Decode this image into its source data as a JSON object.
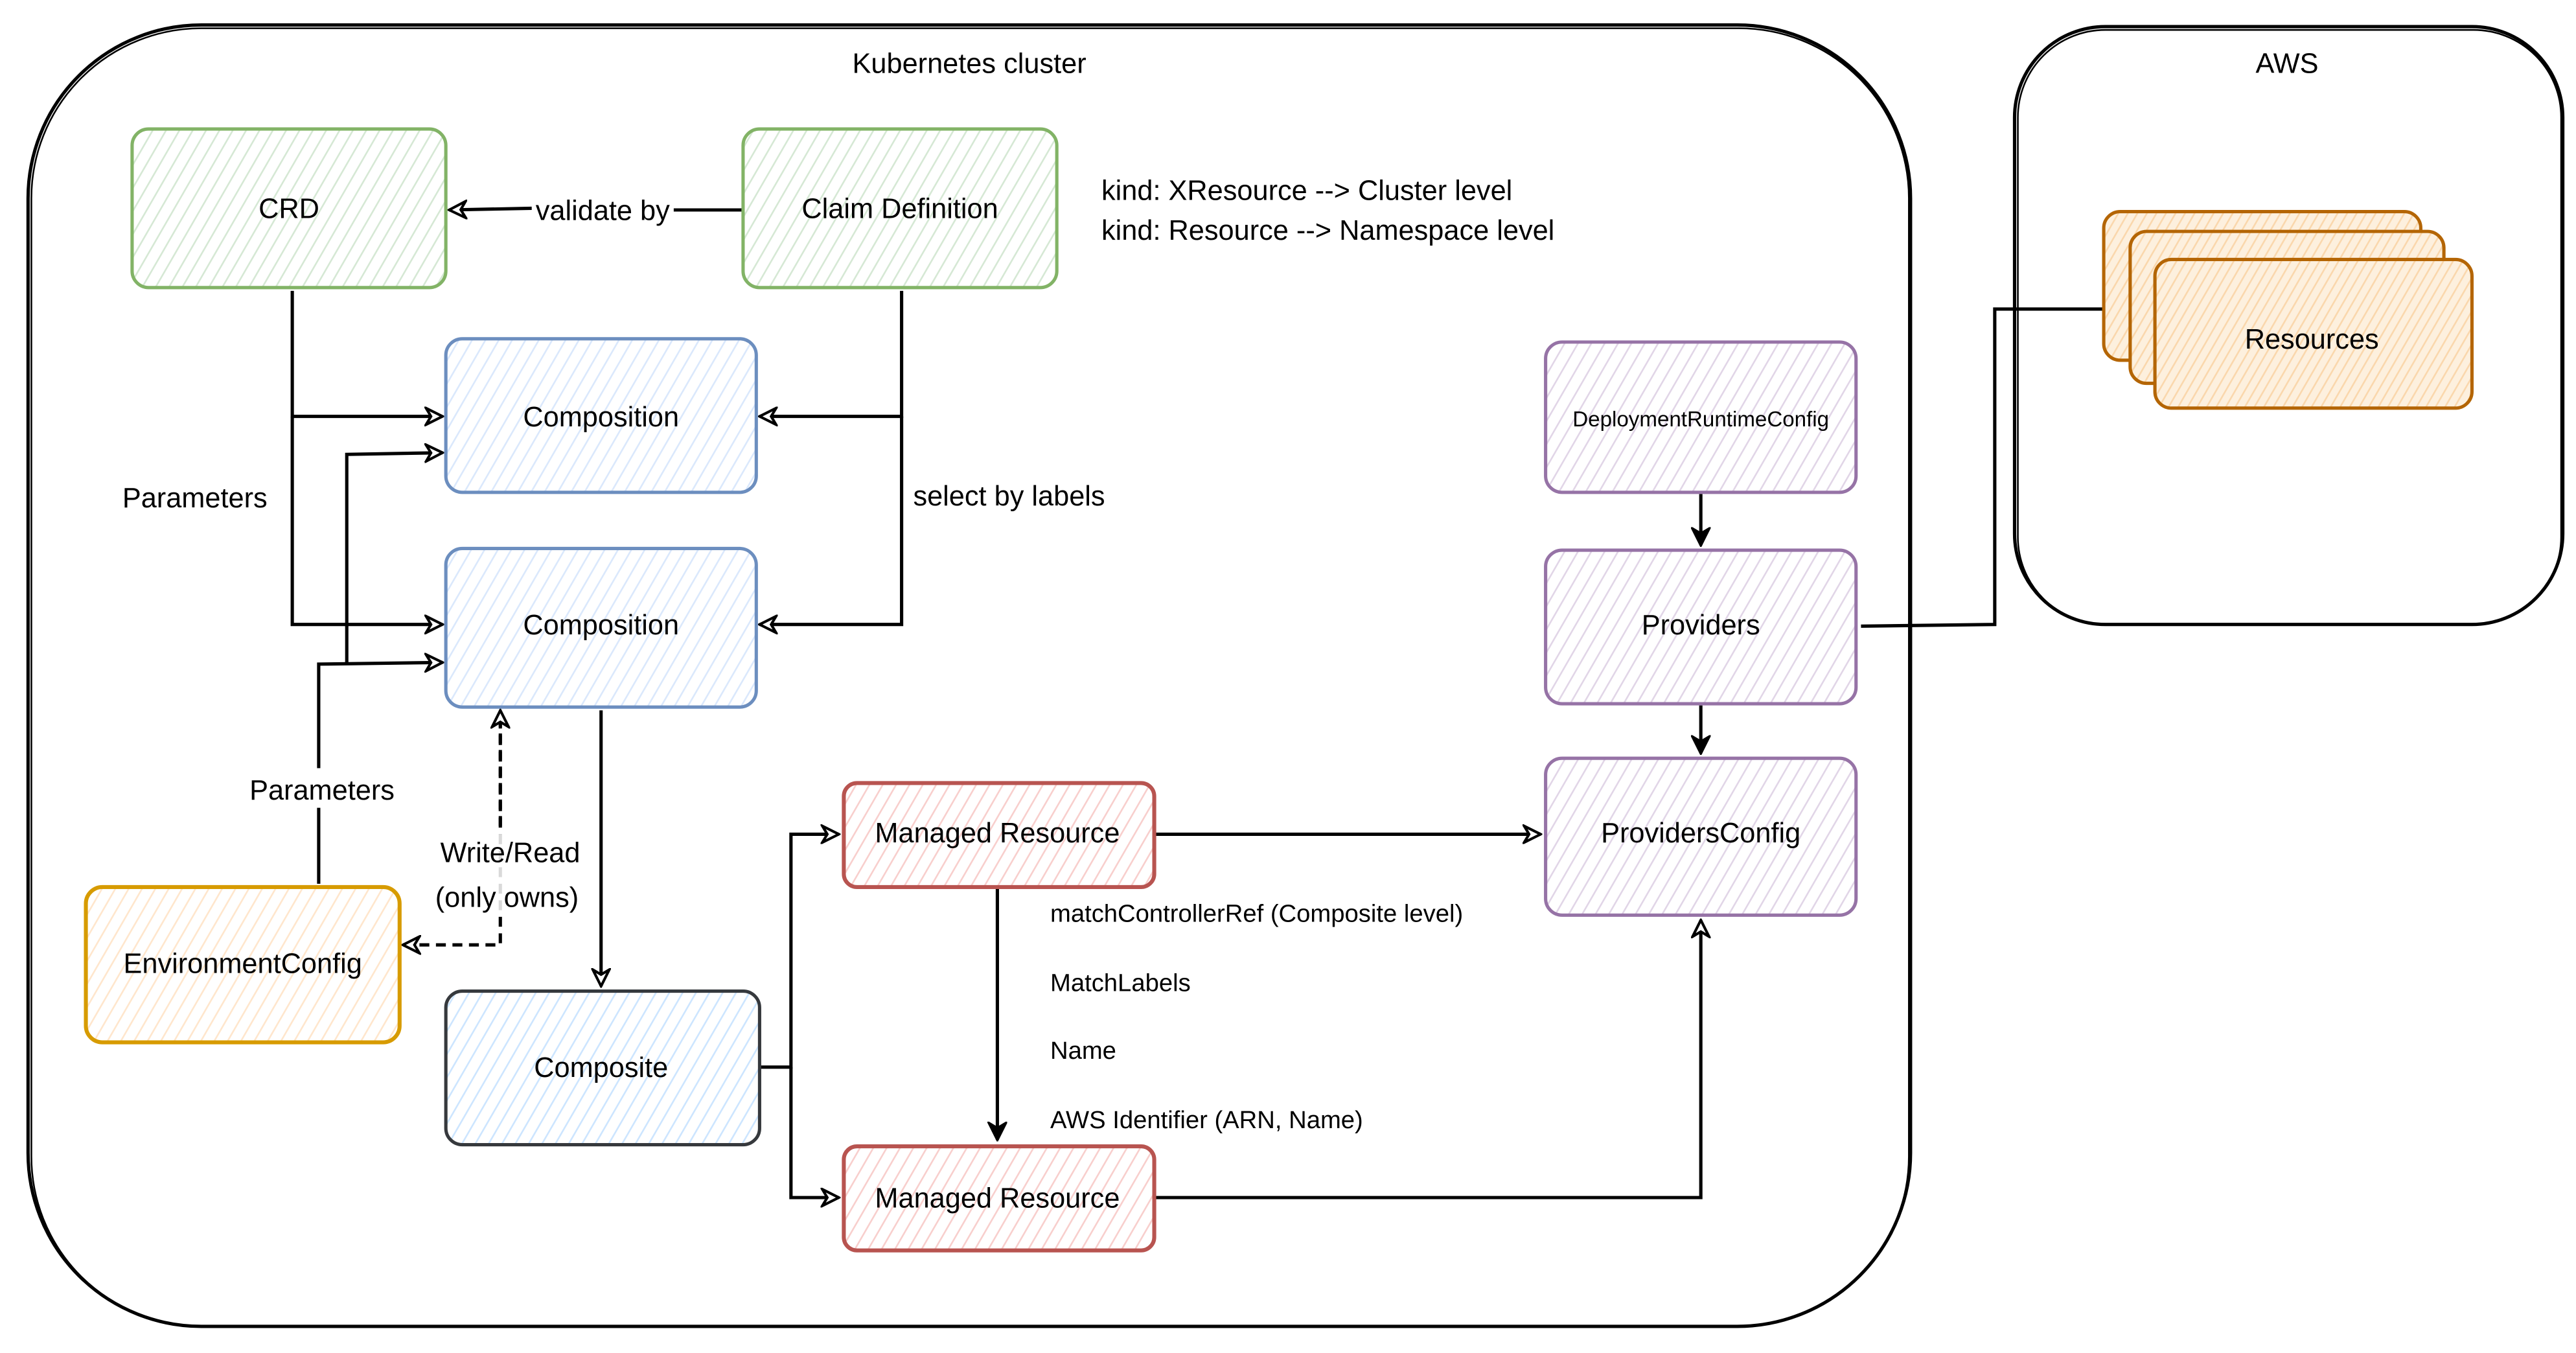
{
  "containers": {
    "kubernetes": {
      "label": "Kubernetes cluster"
    },
    "aws": {
      "label": "AWS"
    }
  },
  "nodes": {
    "crd": {
      "label": "CRD",
      "stroke": "#82b366",
      "fill": "#d5e8d4"
    },
    "claim_definition": {
      "label": "Claim Definition",
      "stroke": "#82b366",
      "fill": "#d5e8d4"
    },
    "composition_1": {
      "label": "Composition",
      "stroke": "#6c8ebf",
      "fill": "#dae8fc"
    },
    "composition_2": {
      "label": "Composition",
      "stroke": "#6c8ebf",
      "fill": "#dae8fc"
    },
    "environment_config": {
      "label": "EnvironmentConfig",
      "stroke": "#d79b00",
      "fill": "#ffe6cc"
    },
    "composite": {
      "label": "Composite",
      "stroke": "#36393d",
      "fill": "#cce5ff"
    },
    "managed_resource_1": {
      "label": "Managed Resource",
      "stroke": "#b85450",
      "fill": "#f8cecc"
    },
    "managed_resource_2": {
      "label": "Managed Resource",
      "stroke": "#b85450",
      "fill": "#f8cecc"
    },
    "deployment_runtime_config": {
      "label": "DeploymentRuntimeConfig",
      "stroke": "#9673a6",
      "fill": "#e1d5e7"
    },
    "providers": {
      "label": "Providers",
      "stroke": "#9673a6",
      "fill": "#e1d5e7"
    },
    "providers_config": {
      "label": "ProvidersConfig",
      "stroke": "#9673a6",
      "fill": "#e1d5e7"
    },
    "resources": {
      "label": "Resources",
      "stroke": "#b46504",
      "fill": "#fad7ac"
    }
  },
  "edge_labels": {
    "validate_by": "validate by",
    "select_by_labels": "select by labels",
    "parameters_crd": "Parameters",
    "parameters_env": "Parameters",
    "write_read_1": "Write/Read",
    "write_read_2": "(only owns)"
  },
  "notes": {
    "kind_line_1": "kind: XResource --> Cluster level",
    "kind_line_2": "kind: Resource --> Namespace level",
    "match_controller_ref": "matchControllerRef (Composite level)",
    "match_labels": "MatchLabels",
    "name": "Name",
    "aws_identifier": "AWS Identifier (ARN, Name)"
  }
}
